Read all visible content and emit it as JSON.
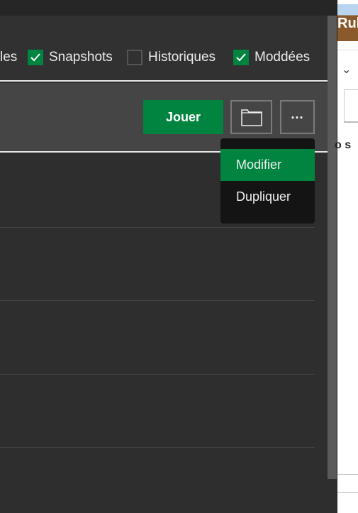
{
  "filters": [
    {
      "label": "les",
      "checked": null
    },
    {
      "label": "Snapshots",
      "checked": true
    },
    {
      "label": "Historiques",
      "checked": false
    },
    {
      "label": "Moddées",
      "checked": true
    }
  ],
  "selected_row": {
    "play_label": "Jouer",
    "folder_icon": "folder-icon",
    "more_icon": "ellipsis-icon",
    "more_label": "..."
  },
  "menu": {
    "items": [
      {
        "label": "Modifier",
        "highlighted": true
      },
      {
        "label": "Dupliquer",
        "highlighted": false
      }
    ]
  },
  "right_panel": {
    "thumb_text": "Rul",
    "snippet": "o s"
  },
  "colors": {
    "accent": "#00843f",
    "background": "#2e2e2e",
    "selected": "#454545"
  }
}
